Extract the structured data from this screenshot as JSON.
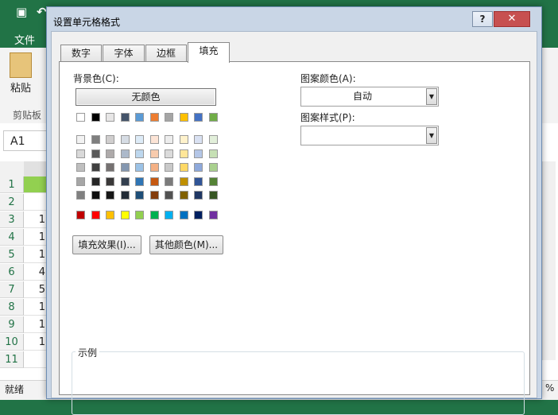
{
  "excel": {
    "menu_file": "文件",
    "paste_label": "粘贴",
    "clipboard_group": "剪贴板",
    "name_box": "A1",
    "status_text": "就绪",
    "status_right": "%",
    "rows": [
      "1",
      "2",
      "3",
      "4",
      "5",
      "6",
      "7",
      "8",
      "9",
      "10",
      "11"
    ],
    "col_a_values": [
      "",
      "",
      "1",
      "1",
      "1",
      "4",
      "5",
      "1",
      "1",
      "1",
      ""
    ]
  },
  "dialog": {
    "title": "设置单元格格式",
    "help_label": "?",
    "close_label": "✕",
    "tabs": [
      "数字",
      "字体",
      "边框",
      "填充"
    ],
    "active_tab": "填充",
    "bg_color_label": "背景色(C):",
    "no_color_label": "无颜色",
    "pattern_color_label": "图案颜色(A):",
    "pattern_color_value": "自动",
    "pattern_style_label": "图案样式(P):",
    "pattern_style_value": "",
    "fill_effects_label": "填充效果(I)...",
    "more_colors_label": "其他颜色(M)...",
    "sample_label": "示例",
    "palette": {
      "theme_top": [
        "#FFFFFF",
        "#000000",
        "#E7E6E6",
        "#44546A",
        "#5B9BD5",
        "#ED7D31",
        "#A5A5A5",
        "#FFC000",
        "#4472C4",
        "#70AD47"
      ],
      "theme_shades": [
        [
          "#F2F2F2",
          "#7F7F7F",
          "#D0CECE",
          "#D6DCE4",
          "#DDEBF7",
          "#FCE4D6",
          "#EDEDED",
          "#FFF2CC",
          "#D9E1F2",
          "#E2EFDA"
        ],
        [
          "#D9D9D9",
          "#595959",
          "#AEAAAA",
          "#ACB9CA",
          "#BDD7EE",
          "#F8CBAD",
          "#DBDBDB",
          "#FFE699",
          "#B4C6E7",
          "#C6E0B4"
        ],
        [
          "#BFBFBF",
          "#404040",
          "#757171",
          "#8497B0",
          "#9BC2E6",
          "#F4B084",
          "#C9C9C9",
          "#FFD966",
          "#8EA9DB",
          "#A9D08E"
        ],
        [
          "#A6A6A6",
          "#262626",
          "#3A3838",
          "#333F4F",
          "#2F75B5",
          "#C65911",
          "#7B7B7B",
          "#BF8F00",
          "#305496",
          "#548235"
        ],
        [
          "#808080",
          "#0D0D0D",
          "#161616",
          "#222B35",
          "#1F4E78",
          "#833C0C",
          "#525252",
          "#806000",
          "#203764",
          "#375623"
        ]
      ],
      "standard": [
        "#C00000",
        "#FF0000",
        "#FFC000",
        "#FFFF00",
        "#92D050",
        "#00B050",
        "#00B0F0",
        "#0070C0",
        "#002060",
        "#7030A0"
      ]
    }
  },
  "colors": {
    "excel_green": "#217346",
    "dialog_frame": "#C9D6E6",
    "close_red": "#C75050"
  }
}
